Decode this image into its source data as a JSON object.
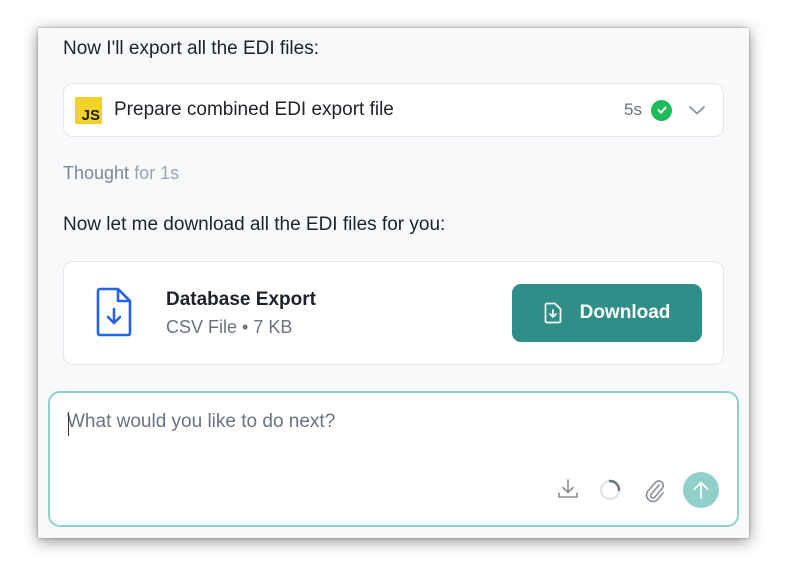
{
  "messages": {
    "export_intro": "Now I'll export all the EDI files:",
    "task": {
      "icon": "js-file-icon",
      "badge_text": "JS",
      "label": "Prepare combined EDI export file",
      "duration": "5s",
      "status": "completed",
      "status_color": "#1fba5a"
    },
    "thought": {
      "prefix": "Thought",
      "duration": "for 1s"
    },
    "download_intro": "Now let me download all the EDI files for you:",
    "file": {
      "icon": "file-download-icon",
      "name": "Database Export",
      "meta": "CSV File • 7 KB",
      "button_label": "Download",
      "button_color": "#2f8f88"
    }
  },
  "composer": {
    "placeholder": "What would you like to do next?",
    "value": "",
    "border_color": "#8fd0cb",
    "tools": [
      "download-icon",
      "spinner-icon",
      "paperclip-icon",
      "send-arrow-icon"
    ]
  }
}
